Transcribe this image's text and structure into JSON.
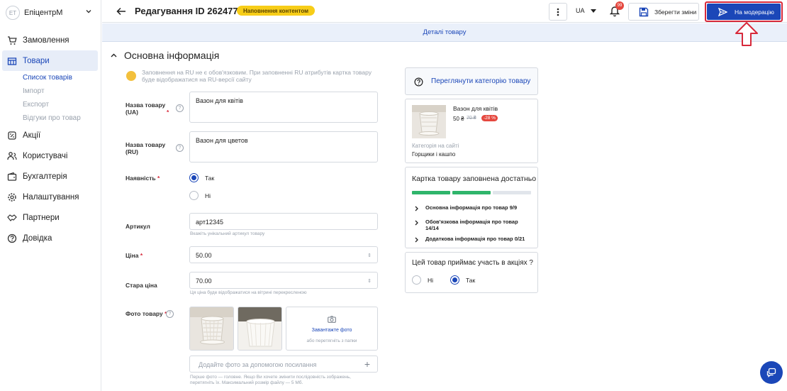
{
  "brand": {
    "avatar": "ЕТ",
    "name": "ЕпіцентрМ"
  },
  "nav": {
    "orders": "Замовлення",
    "products": "Товари",
    "sub": {
      "list": "Список товарів",
      "import": "Імпорт",
      "export": "Експорт",
      "reviews": "Відгуки про товар"
    },
    "promos": "Акції",
    "users": "Користувачі",
    "accounting": "Бухгалтерія",
    "settings": "Налаштування",
    "partners": "Партнери",
    "help": "Довідка"
  },
  "header": {
    "title": "Редагування ID 26247760",
    "status_badge": "Наповнення контентом",
    "lang": "UA",
    "notifications": "99",
    "save_label": "Зберегти зміни",
    "moderate_label": "На модерацію"
  },
  "subbar": {
    "label": "Деталі товару"
  },
  "section": {
    "title": "Основна інформація",
    "hint": "Заповнення на RU не є обов'язковим. При заповненні RU атрибутів картка товару буде відображатися на RU-версії сайту"
  },
  "form": {
    "name_ua_label": "Назва товару (UA)",
    "name_ua_value": "Вазон для квітів",
    "name_ru_label": "Назва товару (RU)",
    "name_ru_value": "Вазон для цветов",
    "availability_label": "Наявність",
    "availability_yes": "Так",
    "availability_no": "Ні",
    "sku_label": "Артикул",
    "sku_value": "арт12345",
    "sku_help": "Вкажіть унікальний артикул товару",
    "price_label": "Ціна",
    "price_value": "50.00",
    "old_price_label": "Стара ціна",
    "old_price_value": "70.00",
    "old_price_help": "Ця ціна буде відображатися на вітрині перекресленою",
    "photo_label": "Фото товару",
    "upload_label": "Завантажте фото",
    "upload_sub": "або перетягніть з папки",
    "url_placeholder": "Додайте фото за допомогою посилання",
    "photo_help": "Перше фото — головне. Якщо Ви хочете змінити послідовність зображень, перетягніть їх. Максимальний розмір файлу — 5 Мб."
  },
  "right": {
    "view_category": "Переглянути категорію товару",
    "preview_name": "Вазон для квітів",
    "preview_price": "50 ₴",
    "preview_old_price": "70 ₴",
    "preview_discount": "-28 %",
    "category_caption": "Категорія на сайті",
    "category_value": "Горщики і кашпо",
    "completeness_title": "Картка товару заповнена достатньо",
    "progress": [
      100,
      100,
      0
    ],
    "sections": [
      "Основна інформація про товар 9/9",
      "Обов'язкова інформація про товар 14/14",
      "Додаткова інформація про товар 0/21"
    ],
    "promo_question": "Цей товар приймає участь в акціях ?",
    "promo_no": "Ні",
    "promo_yes": "Так"
  },
  "colors": {
    "accent": "#1b47b8",
    "badge": "#f7cd18",
    "progress": "#2fb56b",
    "highlight": "#d7293a"
  }
}
